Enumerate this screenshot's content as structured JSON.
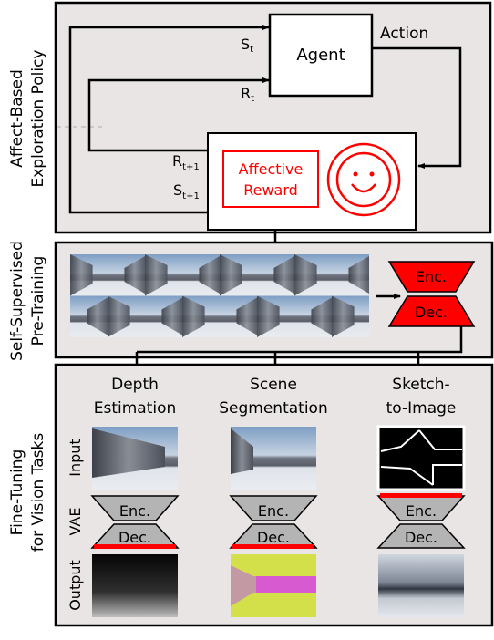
{
  "panels": {
    "policy": {
      "label_line1": "Affect-Based",
      "label_line2": "Exploration Policy"
    },
    "pretraining": {
      "label_line1": "Self-Supervised",
      "label_line2": "Pre-Training"
    },
    "finetuning": {
      "label_line1": "Fine-Tuning",
      "label_line2": "for Vision Tasks"
    }
  },
  "policy": {
    "agent": "Agent",
    "action": "Action",
    "state": "S",
    "state_sub": "t",
    "reward": "R",
    "reward_sub": "t",
    "next_reward": "R",
    "next_reward_sub": "t+1",
    "next_state": "S",
    "next_state_sub": "t+1",
    "affective_line1": "Affective",
    "affective_line2": "Reward",
    "smiley_icon": "smiley-face-icon"
  },
  "pretraining": {
    "enc": "Enc.",
    "dec": "Dec."
  },
  "tasks": [
    {
      "line1": "Depth",
      "line2": "Estimation",
      "enc": "Enc.",
      "dec": "Dec."
    },
    {
      "line1": "Scene",
      "line2": "Segmentation",
      "enc": "Enc.",
      "dec": "Dec."
    },
    {
      "line1": "Sketch-",
      "line2": "to-Image",
      "enc": "Enc.",
      "dec": "Dec."
    }
  ],
  "rows": {
    "input": "Input",
    "vae": "VAE",
    "output": "Output"
  },
  "colors": {
    "accent": "#ff0000",
    "panel": "#e9e5e5",
    "vae_gray": "#b4b4b4"
  }
}
